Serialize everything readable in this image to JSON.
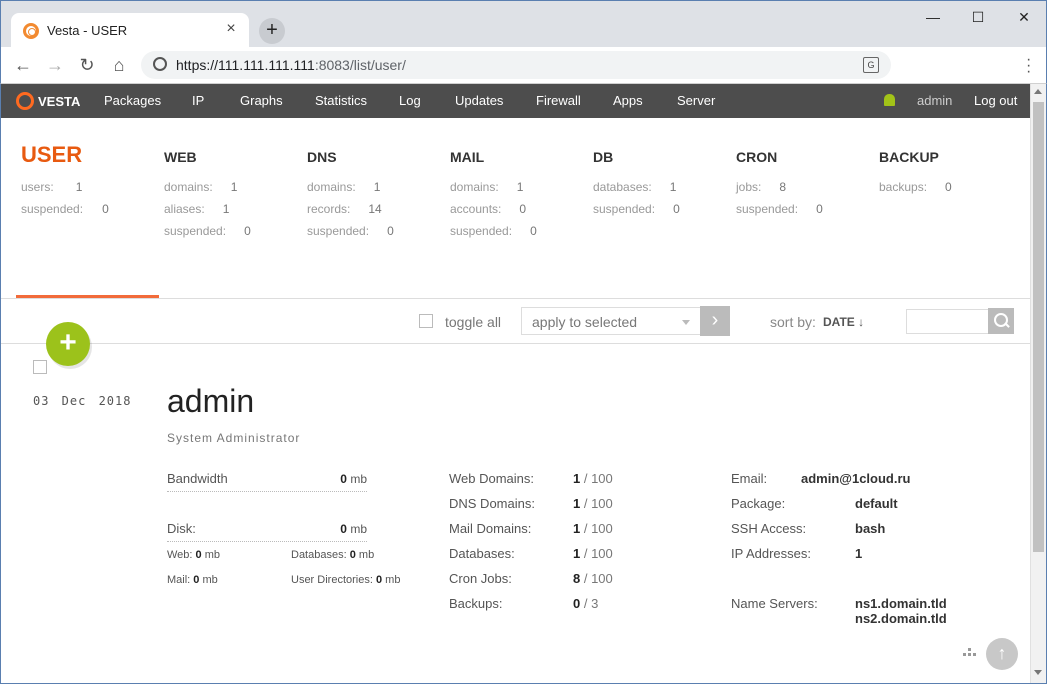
{
  "browser": {
    "tab_title": "Vesta - USER",
    "url_host": "https://111.111.111.111",
    "url_rest": ":8083/list/user/",
    "new_tab": "+",
    "close_tab": "×",
    "minimize": "—",
    "maximize": "☐",
    "close_window": "✕"
  },
  "nav": {
    "logo": "VESTA",
    "items": [
      "Packages",
      "IP",
      "Graphs",
      "Statistics",
      "Log",
      "Updates",
      "Firewall",
      "Apps",
      "Server"
    ],
    "user": "admin",
    "logout": "Log out"
  },
  "summary": {
    "user": {
      "title": "USER",
      "rows": [
        {
          "label": "users:",
          "value": "1"
        },
        {
          "label": "suspended:",
          "value": "0"
        }
      ]
    },
    "web": {
      "title": "WEB",
      "rows": [
        {
          "label": "domains:",
          "value": "1"
        },
        {
          "label": "aliases:",
          "value": "1"
        },
        {
          "label": "suspended:",
          "value": "0"
        }
      ]
    },
    "dns": {
      "title": "DNS",
      "rows": [
        {
          "label": "domains:",
          "value": "1"
        },
        {
          "label": "records:",
          "value": "14"
        },
        {
          "label": "suspended:",
          "value": "0"
        }
      ]
    },
    "mail": {
      "title": "MAIL",
      "rows": [
        {
          "label": "domains:",
          "value": "1"
        },
        {
          "label": "accounts:",
          "value": "0"
        },
        {
          "label": "suspended:",
          "value": "0"
        }
      ]
    },
    "db": {
      "title": "DB",
      "rows": [
        {
          "label": "databases:",
          "value": "1"
        },
        {
          "label": "suspended:",
          "value": "0"
        }
      ]
    },
    "cron": {
      "title": "CRON",
      "rows": [
        {
          "label": "jobs:",
          "value": "8"
        },
        {
          "label": "suspended:",
          "value": "0"
        }
      ]
    },
    "backup": {
      "title": "BACKUP",
      "rows": [
        {
          "label": "backups:",
          "value": "0"
        }
      ]
    }
  },
  "controls": {
    "toggle_all": "toggle all",
    "apply_selected": "apply to selected",
    "sort_by": "sort by:",
    "sort_value": "DATE ↓",
    "add": "+"
  },
  "user_entry": {
    "date": "03 Dec 2018",
    "username": "admin",
    "fullname": "System Administrator",
    "bandwidth_label": "Bandwidth",
    "bandwidth_value": "0",
    "disk_label": "Disk:",
    "disk_value": "0",
    "unit": "mb",
    "web_label": "Web:",
    "web_value": "0",
    "databases_label": "Databases:",
    "databases_value": "0",
    "mail_label": "Mail:",
    "mail_value": "0",
    "userdirs_label": "User Directories:",
    "userdirs_value": "0",
    "limits": [
      {
        "label": "Web Domains:",
        "used": "1",
        "max": "100"
      },
      {
        "label": "DNS Domains:",
        "used": "1",
        "max": "100"
      },
      {
        "label": "Mail Domains:",
        "used": "1",
        "max": "100"
      },
      {
        "label": "Databases:",
        "used": "1",
        "max": "100"
      },
      {
        "label": "Cron Jobs:",
        "used": "8",
        "max": "100"
      },
      {
        "label": "Backups:",
        "used": "0",
        "max": "3"
      }
    ],
    "email_label": "Email:",
    "email_value": "admin@1cloud.ru",
    "package_label": "Package:",
    "package_value": "default",
    "ssh_label": "SSH Access:",
    "ssh_value": "bash",
    "ip_label": "IP Addresses:",
    "ip_value": "1",
    "ns_label": "Name Servers:",
    "ns1": "ns1.domain.tld",
    "ns2": "ns2.domain.tld"
  },
  "colors": {
    "accent": "#e85a10",
    "add_button": "#9cc21b",
    "nav_bg": "#4d4d4d"
  }
}
